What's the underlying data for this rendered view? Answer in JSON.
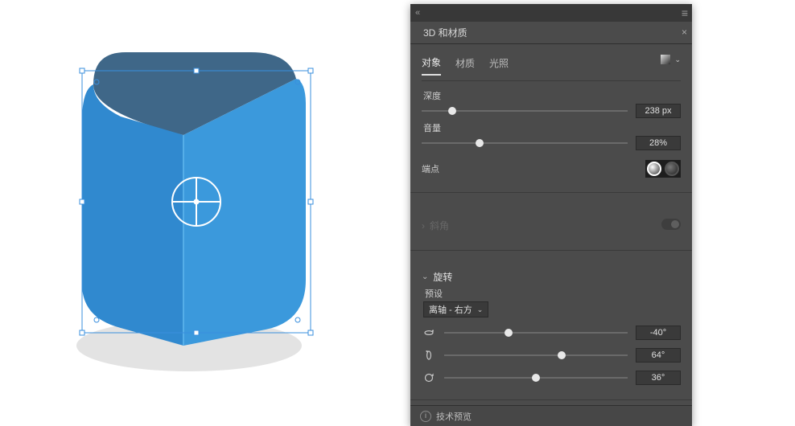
{
  "panel": {
    "collapse_icon": "collapse",
    "title": "3D 和材质",
    "close_icon": "close",
    "tabs": [
      {
        "label": "对象",
        "active": true
      },
      {
        "label": "材质",
        "active": false
      },
      {
        "label": "光照",
        "active": false
      }
    ],
    "tab_menu_icon": "gradient-menu",
    "depth": {
      "label": "深度",
      "value": "238 px",
      "pct": 15
    },
    "volume": {
      "label": "音量",
      "value": "28%",
      "pct": 28
    },
    "endpoint": {
      "label": "端点"
    },
    "bevel": {
      "label": "斜角",
      "enabled": false
    },
    "rotation": {
      "label": "旋转",
      "preset_label": "预设",
      "preset_value": "离轴 - 右方",
      "x": {
        "value": "-40°",
        "pct": 35
      },
      "y": {
        "value": "64°",
        "pct": 64
      },
      "z": {
        "value": "36°",
        "pct": 50
      }
    },
    "footer": "技术预览"
  }
}
